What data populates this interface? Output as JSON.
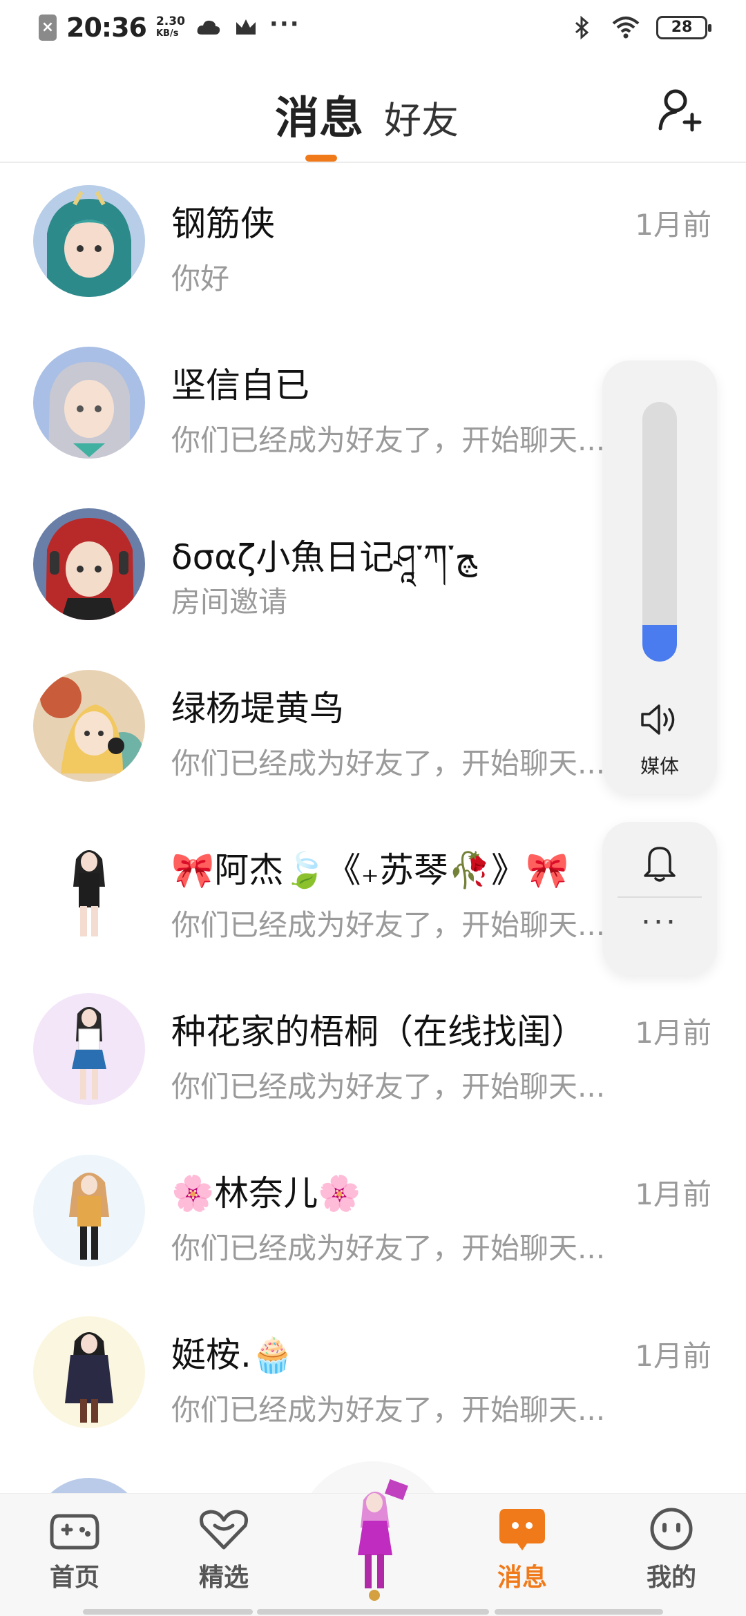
{
  "status_bar": {
    "time": "20:36",
    "speed_value": "2.30",
    "speed_unit": "KB/s",
    "more": "···",
    "battery": "28"
  },
  "header": {
    "tab_messages": "消息",
    "tab_friends": "好友"
  },
  "chats": [
    {
      "name": "钢筋侠",
      "preview": "你好",
      "time": "1月前"
    },
    {
      "name": "坚信自已",
      "preview": "你们已经成为好友了，开始聊天...",
      "time": ""
    },
    {
      "name": "δσαζ小魚日记ཤཱ་ཀ་ﭻ",
      "preview": "房间邀请",
      "time": ""
    },
    {
      "name": "绿杨堤黄鸟",
      "preview": "你们已经成为好友了，开始聊天...",
      "time": ""
    },
    {
      "name": "🎀阿杰🍃《₊苏琴🥀》🎀",
      "preview": "你们已经成为好友了，开始聊天...",
      "time": ""
    },
    {
      "name": "种花家的梧桐（在线找闺）",
      "preview": "你们已经成为好友了，开始聊天...",
      "time": "1月前"
    },
    {
      "name": "🌸林奈儿🌸",
      "preview": "你们已经成为好友了，开始聊天...",
      "time": "1月前"
    },
    {
      "name": "娗桉.🧁",
      "preview": "你们已经成为好友了，开始聊天...",
      "time": "1月前"
    }
  ],
  "volume": {
    "label": "媒体",
    "level": 0.14,
    "more": "···",
    "accent": "#4a7cf0"
  },
  "nav": {
    "home": "首页",
    "featured": "精选",
    "messages": "消息",
    "mine": "我的",
    "active_color": "#f07a1a"
  }
}
